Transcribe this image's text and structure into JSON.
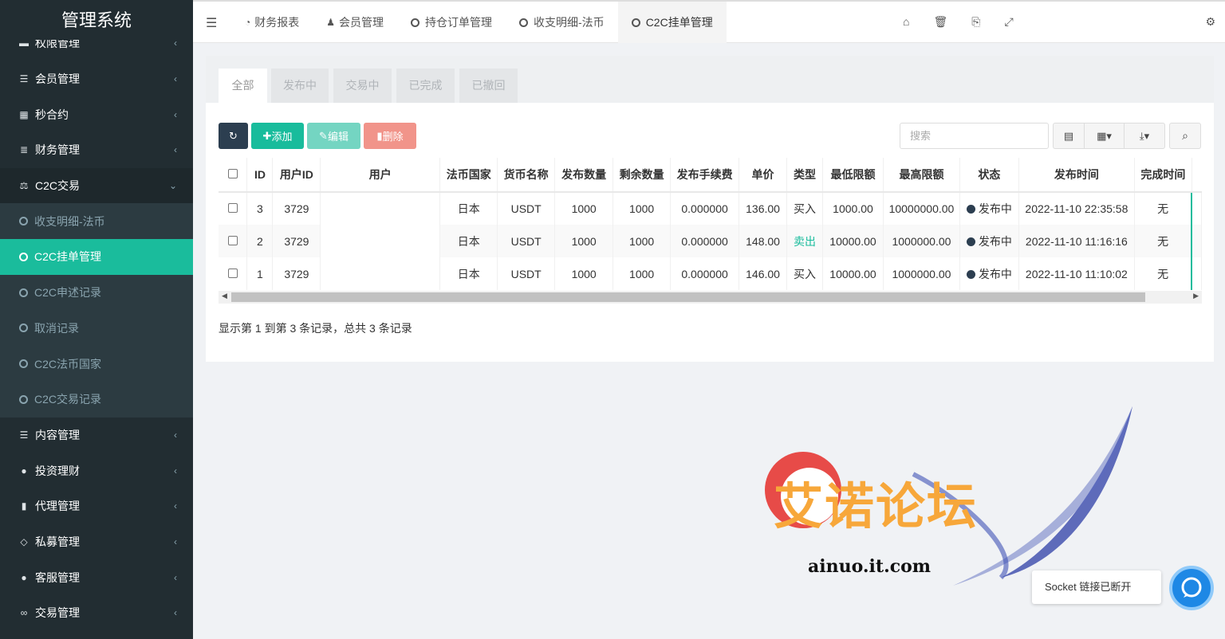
{
  "app": {
    "title": "管理系统"
  },
  "sidebar": {
    "items": [
      {
        "label": "权限管理",
        "icon": "group-icon"
      },
      {
        "label": "会员管理",
        "icon": "list-icon"
      },
      {
        "label": "秒合约",
        "icon": "calendar-icon"
      },
      {
        "label": "财务管理",
        "icon": "database-icon"
      },
      {
        "label": "C2C交易",
        "icon": "balance-icon"
      }
    ],
    "subitems": [
      {
        "label": "收支明细-法币"
      },
      {
        "label": "C2C挂单管理"
      },
      {
        "label": "C2C申述记录"
      },
      {
        "label": "取消记录"
      },
      {
        "label": "C2C法币国家"
      },
      {
        "label": "C2C交易记录"
      }
    ],
    "items_after": [
      {
        "label": "内容管理",
        "icon": "align-icon"
      },
      {
        "label": "投资理财",
        "icon": "compass-icon"
      },
      {
        "label": "代理管理",
        "icon": "briefcase-icon"
      },
      {
        "label": "私募管理",
        "icon": "diamond-icon"
      },
      {
        "label": "客服管理",
        "icon": "comment-icon"
      },
      {
        "label": "交易管理",
        "icon": "handshake-icon"
      }
    ]
  },
  "header": {
    "tabs": [
      {
        "label": "财务报表",
        "icon": "dashboard-icon"
      },
      {
        "label": "会员管理",
        "icon": "user-icon"
      },
      {
        "label": "持仓订单管理",
        "icon": "circle-icon"
      },
      {
        "label": "收支明细-法币",
        "icon": "circle-icon"
      },
      {
        "label": "C2C挂单管理",
        "icon": "circle-icon"
      }
    ]
  },
  "filter_tabs": [
    "全部",
    "发布中",
    "交易中",
    "已完成",
    "已撤回"
  ],
  "toolbar": {
    "add_label": "添加",
    "edit_label": "编辑",
    "delete_label": "删除",
    "search_placeholder": "搜索"
  },
  "table": {
    "columns": [
      "ID",
      "用户ID",
      "用户",
      "法币国家",
      "货币名称",
      "发布数量",
      "剩余数量",
      "发布手续费",
      "单价",
      "类型",
      "最低限额",
      "最高限额",
      "状态",
      "发布时间",
      "完成时间"
    ],
    "rows": [
      {
        "id": "3",
        "user_id": "3729",
        "user": "",
        "country": "日本",
        "currency": "USDT",
        "qty": "1000",
        "remain": "1000",
        "fee": "0.000000",
        "price": "136.00",
        "type": "买入",
        "min": "1000.00",
        "max": "10000000.00",
        "status": "发布中",
        "time": "2022-11-10 22:35:58",
        "done": "无"
      },
      {
        "id": "2",
        "user_id": "3729",
        "user": "",
        "country": "日本",
        "currency": "USDT",
        "qty": "1000",
        "remain": "1000",
        "fee": "0.000000",
        "price": "148.00",
        "type": "卖出",
        "min": "10000.00",
        "max": "1000000.00",
        "status": "发布中",
        "time": "2022-11-10 11:16:16",
        "done": "无"
      },
      {
        "id": "1",
        "user_id": "3729",
        "user": "",
        "country": "日本",
        "currency": "USDT",
        "qty": "1000",
        "remain": "1000",
        "fee": "0.000000",
        "price": "146.00",
        "type": "买入",
        "min": "10000.00",
        "max": "1000000.00",
        "status": "发布中",
        "time": "2022-11-10 11:10:02",
        "done": "无"
      }
    ]
  },
  "pager": {
    "text": "显示第 1 到第 3 条记录，总共 3 条记录"
  },
  "watermark": {
    "text": "艾诺论坛",
    "url": "ainuo.it.com"
  },
  "toast": {
    "text": "Socket 链接已断开"
  },
  "colors": {
    "accent": "#18bc9c",
    "sidebar": "#222d32",
    "dark": "#2c3e50"
  }
}
